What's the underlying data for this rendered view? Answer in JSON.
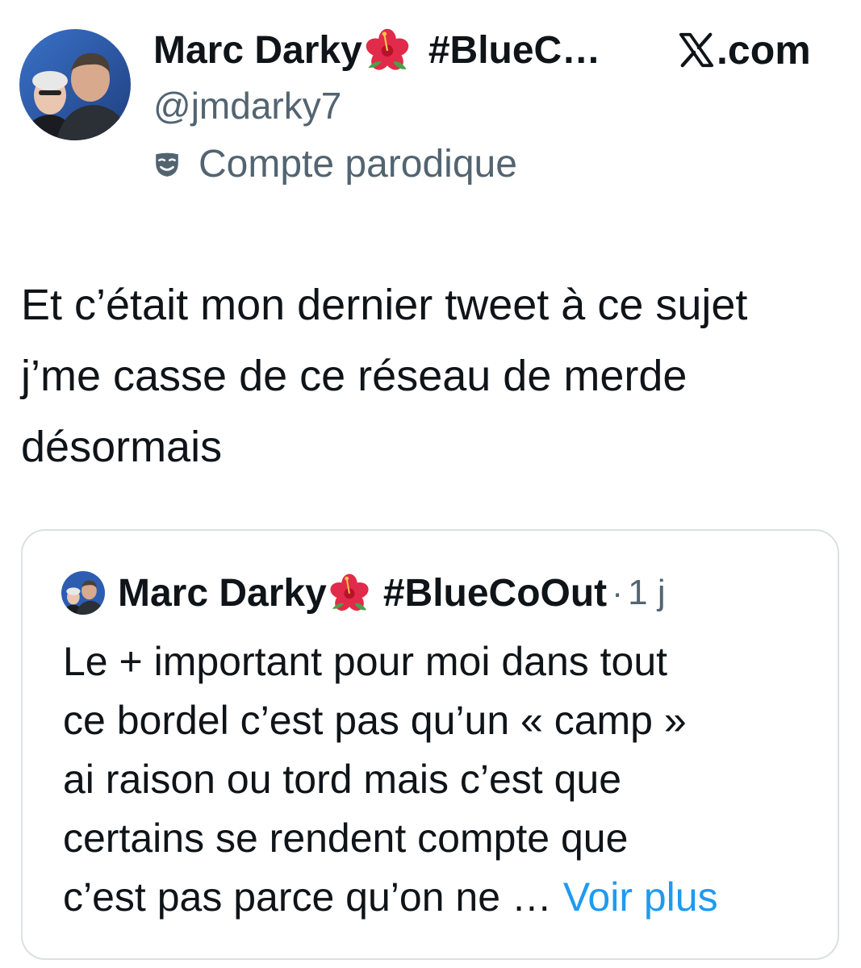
{
  "header": {
    "display_name": "Marc Darky",
    "name_emoji": "hibiscus-icon",
    "hashtag_truncated": "#BlueC…",
    "site": ".com",
    "site_logo": "x-logo-icon",
    "handle": "@jmdarky7",
    "badge_icon": "parody-mask-icon",
    "badge_label": "Compte parodique"
  },
  "tweet": {
    "text": "Et c’était mon dernier tweet à ce sujet\nj’me casse de ce réseau de merde\ndésormais"
  },
  "quote": {
    "display_name": "Marc Darky",
    "name_emoji": "hibiscus-icon",
    "hashtag": "#BlueCoOut",
    "separator": "·",
    "time": "1 j",
    "lines": [
      "Le + important pour moi dans tout",
      "ce bordel c’est pas qu’un « camp »",
      "ai raison ou tord mais c’est que",
      "certains se rendent compte que",
      "c’est pas parce qu’on ne …"
    ],
    "more_label": " Voir plus"
  },
  "colors": {
    "text": "#0f1419",
    "secondary": "#536471",
    "link": "#1d9bf0",
    "border": "#dcdfe3"
  }
}
